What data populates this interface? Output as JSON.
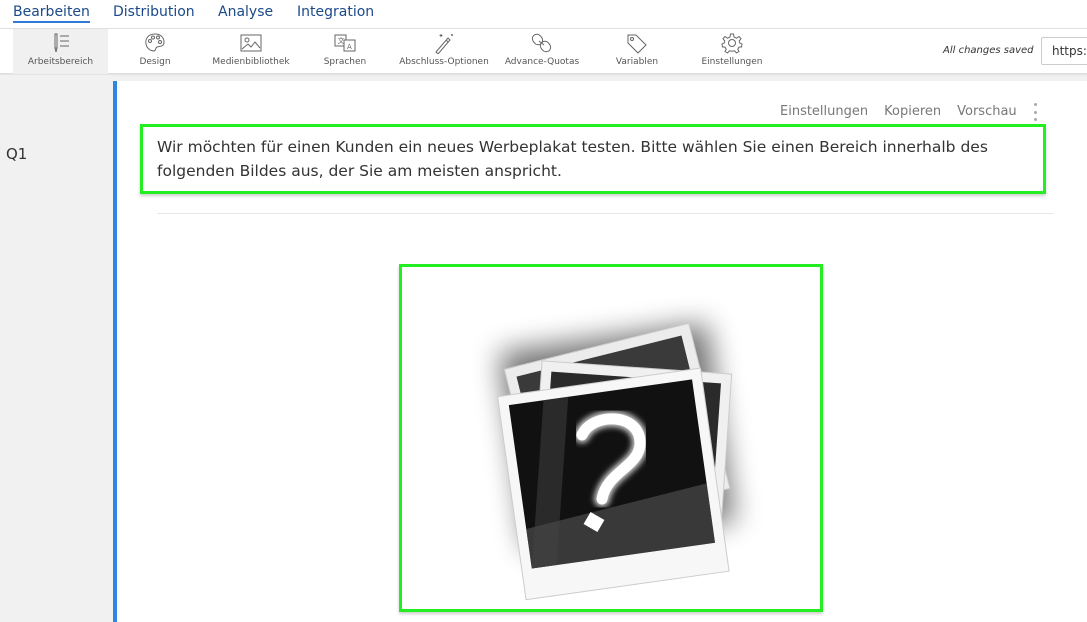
{
  "topnav": {
    "tabs": [
      {
        "label": "Bearbeiten",
        "active": true
      },
      {
        "label": "Distribution",
        "active": false
      },
      {
        "label": "Analyse",
        "active": false
      },
      {
        "label": "Integration",
        "active": false
      }
    ]
  },
  "toolbar": {
    "items": [
      {
        "label": "Arbeitsbereich",
        "icon": "workspace-icon",
        "active": true
      },
      {
        "label": "Design",
        "icon": "palette-icon",
        "active": false
      },
      {
        "label": "Medienbibliothek",
        "icon": "image-icon",
        "active": false
      },
      {
        "label": "Sprachen",
        "icon": "translate-icon",
        "active": false
      },
      {
        "label": "Abschluss-Optionen",
        "icon": "magic-wand-icon",
        "active": false
      },
      {
        "label": "Advance-Quotas",
        "icon": "link-icon",
        "active": false
      },
      {
        "label": "Variablen",
        "icon": "tag-icon",
        "active": false
      },
      {
        "label": "Einstellungen",
        "icon": "gear-icon",
        "active": false
      }
    ],
    "status": "All changes saved",
    "url_value": "https://"
  },
  "question": {
    "id": "Q1",
    "actions": [
      "Einstellungen",
      "Kopieren",
      "Vorschau"
    ],
    "text": "Wir möchten für einen Kunden ein neues Werbeplakat testen. Bitte wählen Sie einen Bereich innerhalb des folgenden Bildes aus, der Sie am meisten anspricht.",
    "image": "missing-image-placeholder-icon"
  },
  "colors": {
    "accent": "#2d86e0",
    "highlight": "#22ee22",
    "nav_text": "#1a4a8a"
  }
}
